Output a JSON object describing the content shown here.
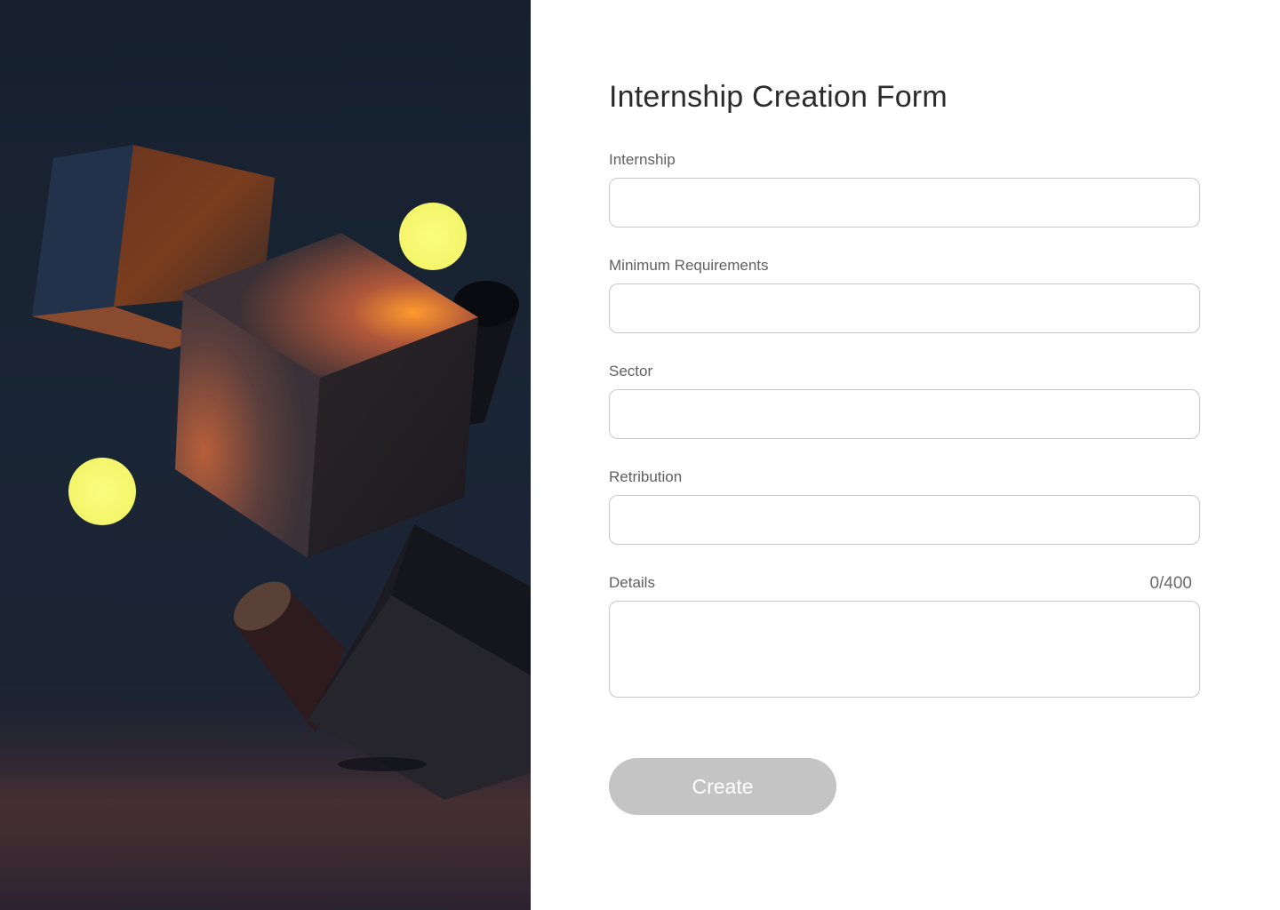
{
  "form": {
    "title": "Internship Creation Form",
    "fields": [
      {
        "label": "Internship",
        "value": "",
        "placeholder": ""
      },
      {
        "label": "Minimum Requirements",
        "value": "",
        "placeholder": ""
      },
      {
        "label": "Sector",
        "value": "",
        "placeholder": ""
      },
      {
        "label": "Retribution",
        "value": "",
        "placeholder": ""
      }
    ],
    "details": {
      "label": "Details",
      "counter": "0/400",
      "value": ""
    },
    "submit_label": "Create"
  },
  "colors": {
    "art_background": "#1a2535",
    "accent_orange": "#ff9a2e",
    "accent_yellow": "#f9fb6e",
    "button_disabled": "#c4c4c4",
    "input_border": "#c9c9c9"
  }
}
